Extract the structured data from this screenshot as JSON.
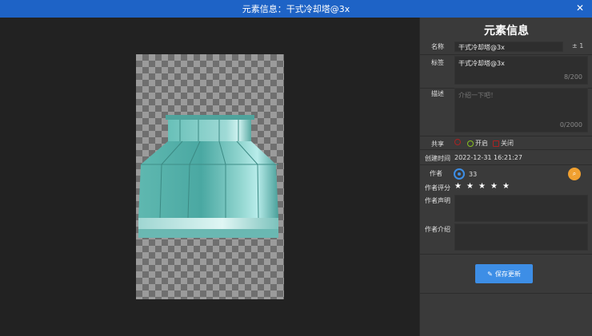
{
  "window": {
    "title": "元素信息：干式冷却塔@3x",
    "close_icon": "close-icon"
  },
  "panel": {
    "heading": "元素信息",
    "name_label": "名称",
    "name_value": "干式冷却塔@3x",
    "name_suffix": "± 1",
    "tags_label": "标签",
    "tags_value": "干式冷却塔@3x",
    "tags_count": "8/200",
    "desc_label": "描述",
    "desc_placeholder": "介绍一下吧！",
    "desc_count": "0/2000",
    "share_label": "共享",
    "share_on": "开启",
    "share_off": "关闭",
    "created_label": "创建时间",
    "created_value": "2022-12-31 16:21:27",
    "author_label": "作者",
    "author_value": "33",
    "rating_label": "作者评分",
    "rating": 5,
    "statement_label": "作者声明",
    "intro_label": "作者介绍",
    "save_label": "保存更新"
  },
  "colors": {
    "titlebar": "#1e63c6",
    "accent": "#3d8ee6",
    "badge": "#f0a030",
    "panel": "#3a3a3a"
  }
}
